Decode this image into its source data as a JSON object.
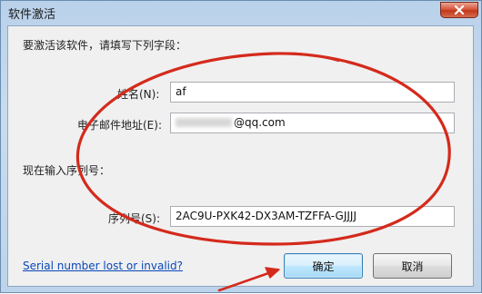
{
  "window": {
    "title": "软件激活"
  },
  "form": {
    "instruction": "要激活该软件，请填写下列字段：",
    "name_label": "姓名(N):",
    "name_value": "af",
    "email_label": "电子邮件地址(E):",
    "email_visible_value": "@qq.com",
    "serial_section_label": "现在输入序列号：",
    "serial_label": "序列号(S):",
    "serial_value": "2AC9U-PXK42-DX3AM-TZFFA-GJJJJ"
  },
  "footer": {
    "lost_link": "Serial number lost or invalid?",
    "ok_label": "确定",
    "cancel_label": "取消"
  },
  "annotation_colors": {
    "ellipse": "#d42a1c",
    "arrow": "#d42a1c"
  }
}
